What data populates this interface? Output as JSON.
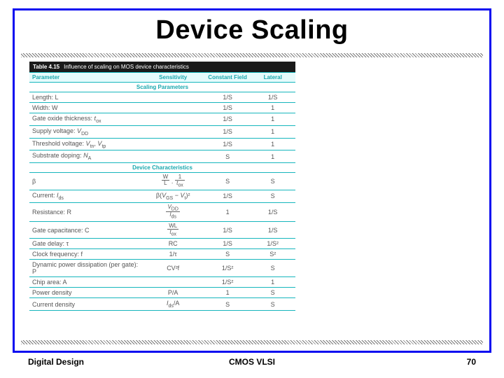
{
  "title": "Device Scaling",
  "footer": {
    "left": "Digital Design",
    "center": "CMOS VLSI",
    "right": "70"
  },
  "table": {
    "caption_label": "Table 4.15",
    "caption_text": "Influence of scaling on MOS device characteristics",
    "headers": {
      "param": "Parameter",
      "sens": "Sensitivity",
      "cf": "Constant Field",
      "lat": "Lateral"
    },
    "section1": "Scaling Parameters",
    "section2": "Device Characteristics",
    "rows_scaling": [
      {
        "param": "Length: L",
        "sens": "",
        "cf": "1/S",
        "lat": "1/S"
      },
      {
        "param": "Width: W",
        "sens": "",
        "cf": "1/S",
        "lat": "1"
      },
      {
        "param": "Gate oxide thickness: tₒₓ",
        "sens": "",
        "cf": "1/S",
        "lat": "1"
      },
      {
        "param": "Supply voltage: V_DD",
        "sens": "",
        "cf": "1/S",
        "lat": "1"
      },
      {
        "param": "Threshold voltage: V_tn, V_tp",
        "sens": "",
        "cf": "1/S",
        "lat": "1"
      },
      {
        "param": "Substrate doping: N_A",
        "sens": "",
        "cf": "S",
        "lat": "1"
      }
    ],
    "rows_device": [
      {
        "param": "β",
        "sens_frac": {
          "n": "W",
          "d": "L"
        },
        "sens_frac2": {
          "n": "1",
          "d": "tₒₓ"
        },
        "cf": "S",
        "lat": "S"
      },
      {
        "param": "Current: I_ds",
        "sens_expr": "β(V_GS − V_t)²",
        "cf": "1/S",
        "lat": "S"
      },
      {
        "param": "Resistance: R",
        "sens_frac": {
          "n": "V_DD",
          "d": "I_ds"
        },
        "cf": "1",
        "lat": "1/S"
      },
      {
        "param": "Gate capacitance: C",
        "sens_frac": {
          "n": "WL",
          "d": "tₒₓ"
        },
        "cf": "1/S",
        "lat": "1/S"
      },
      {
        "param": "Gate delay: τ",
        "sens": "RC",
        "cf": "1/S",
        "lat": "1/S²"
      },
      {
        "param": "Clock frequency: f",
        "sens": "1/τ",
        "cf": "S",
        "lat": "S²"
      },
      {
        "param": "Dynamic power dissipation (per gate): P",
        "sens": "CV²f",
        "cf": "1/S²",
        "lat": "S"
      },
      {
        "param": "Chip area: A",
        "sens": "",
        "cf": "1/S²",
        "lat": "1"
      },
      {
        "param": "Power density",
        "sens": "P/A",
        "cf": "1",
        "lat": "S"
      },
      {
        "param": "Current density",
        "sens": "I_ds/A",
        "cf": "S",
        "lat": "S"
      }
    ]
  }
}
